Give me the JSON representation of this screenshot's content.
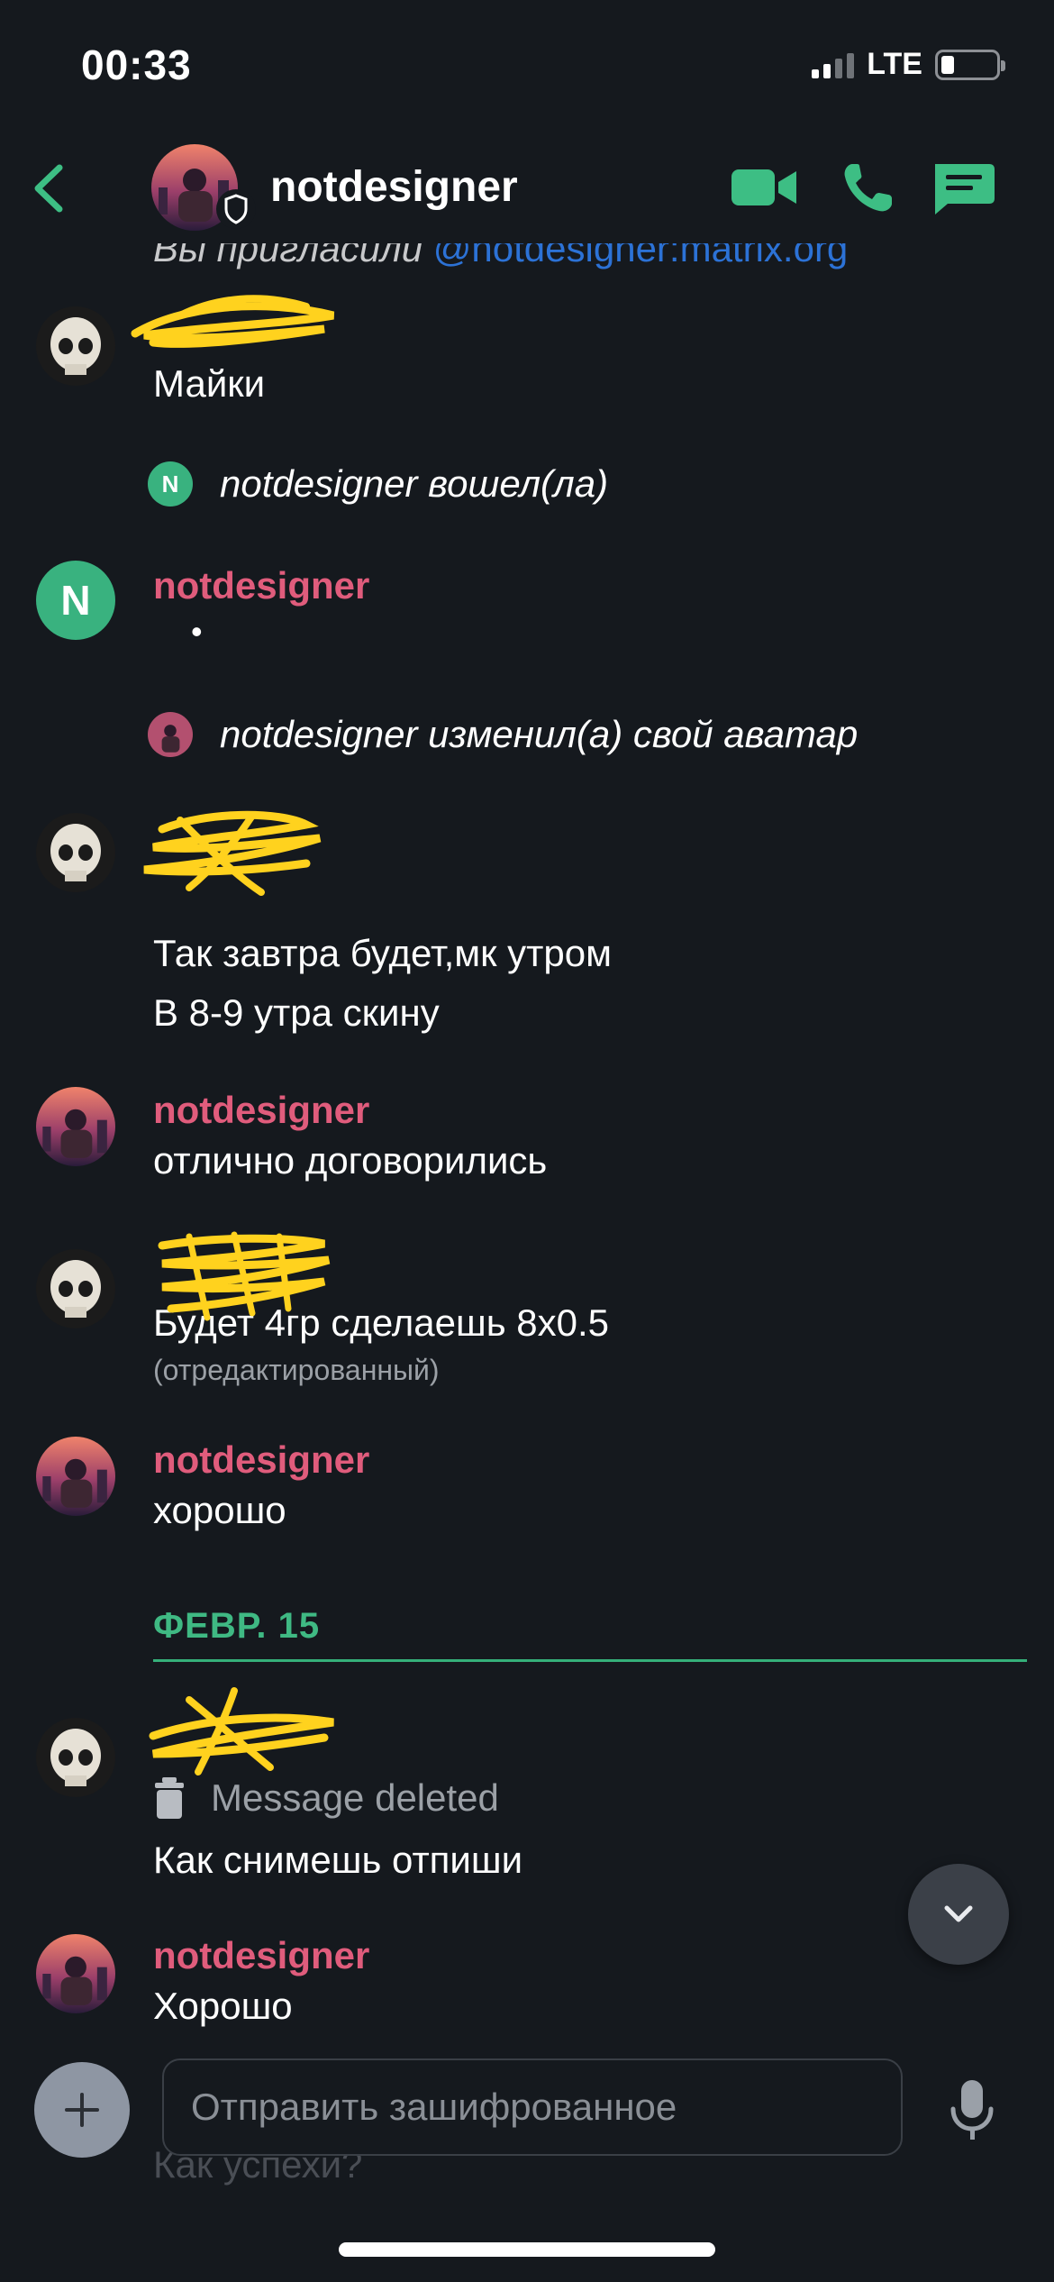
{
  "status_bar": {
    "time": "00:33",
    "network": "LTE",
    "icons": [
      "cellular-signal-icon",
      "battery-icon"
    ]
  },
  "header": {
    "room_name": "notdesigner",
    "icons": [
      "back-icon",
      "shield-icon",
      "video-call-icon",
      "voice-call-icon",
      "threads-icon"
    ],
    "accent_color": "#3dbe84"
  },
  "timeline": {
    "cut_event": {
      "text": "Вы пригласили",
      "mention": "@notdesigner:matrix.org"
    },
    "items": [
      {
        "kind": "message",
        "sender": "",
        "sender_hidden": true,
        "body": "Майки"
      },
      {
        "kind": "event",
        "actor": "notdesigner",
        "text": "notdesigner вошел(ла)"
      },
      {
        "kind": "message",
        "sender": "notdesigner",
        "avatar_initial": "N",
        "body": "•"
      },
      {
        "kind": "event",
        "actor": "notdesigner",
        "text": "notdesigner изменил(а) свой аватар"
      },
      {
        "kind": "message",
        "sender": "",
        "sender_hidden": true,
        "lines": [
          "Так завтра будет,мк утром",
          "В 8-9 утра скину"
        ]
      },
      {
        "kind": "message",
        "sender": "notdesigner",
        "body": "отлично договорились"
      },
      {
        "kind": "message",
        "sender": "",
        "sender_hidden": true,
        "body": "Будет 4гр сделаешь 8x0.5",
        "edited_label": "(отредактированный)"
      },
      {
        "kind": "message",
        "sender": "notdesigner",
        "body": "хорошо"
      },
      {
        "kind": "date_separator",
        "label": "ФЕВР. 15"
      },
      {
        "kind": "message",
        "sender": "",
        "sender_hidden": true,
        "deleted_label": "Message deleted",
        "body": "Как снимешь отпиши"
      },
      {
        "kind": "message",
        "sender": "notdesigner",
        "body": "Хорошо"
      }
    ],
    "under_composer_text": "Как успехи?"
  },
  "composer": {
    "placeholder": "Отправить зашифрованное",
    "icons": [
      "add-icon",
      "microphone-icon"
    ]
  },
  "scroll_button": {
    "icon": "chevron-down-icon"
  },
  "colors": {
    "background": "#15191e",
    "sender_name": "#e05c7c",
    "accent_green": "#3dbe84",
    "scribble": "#ffd21e"
  }
}
